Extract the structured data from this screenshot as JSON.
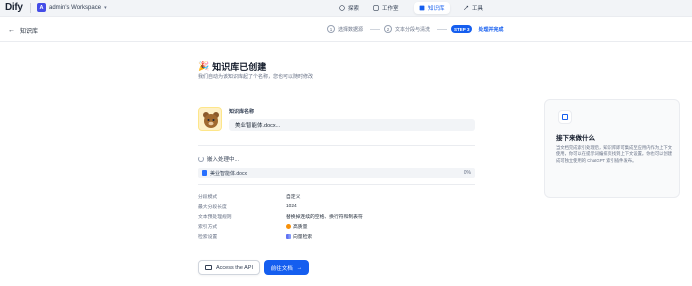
{
  "topbar": {
    "logo": "Dify",
    "workspace_initial": "A",
    "workspace_name": "admin's Workspace",
    "nav": [
      {
        "label": "探索"
      },
      {
        "label": "工作室"
      },
      {
        "label": "知识库"
      },
      {
        "label": "工具"
      }
    ]
  },
  "header": {
    "back_label": "知识库",
    "steps": [
      {
        "num": "1",
        "label": "选择数据源"
      },
      {
        "num": "2",
        "label": "文本分段与清洗"
      },
      {
        "badge": "STEP 3",
        "label": "处理并完成"
      }
    ]
  },
  "main": {
    "title": "知识库已创建",
    "subtitle": "我们自动为该知识库起了个名称，您也可以随时修改",
    "kb_name_label": "知识库名称",
    "kb_name_value": "美业智能体.docx...",
    "embedding_status": "嵌入处理中...",
    "file": {
      "name": "美业智能体.docx",
      "progress": "0%"
    },
    "settings": [
      {
        "key": "分段模式",
        "value": "自定义"
      },
      {
        "key": "最大分段长度",
        "value": "1024"
      },
      {
        "key": "文本预处理规则",
        "value": "替换掉连续的空格、换行符和制表符"
      },
      {
        "key": "索引方式",
        "value": "高质量"
      },
      {
        "key": "检索设置",
        "value": "向量检索"
      }
    ],
    "api_button": "Access the API",
    "doc_button": "前往文档"
  },
  "next_panel": {
    "title": "接下来做什么",
    "desc": "当文档完成索引处理后，知识库即可集成至应用内作为上下文使用，你可以在提示词编排页找到上下文设置。你也可以创建成可独立使用的 ChatGPT 索引插件发布。"
  },
  "colors": {
    "accent": "#155eef",
    "badge_bg": "#155eef",
    "status_warn": "#f79009"
  }
}
